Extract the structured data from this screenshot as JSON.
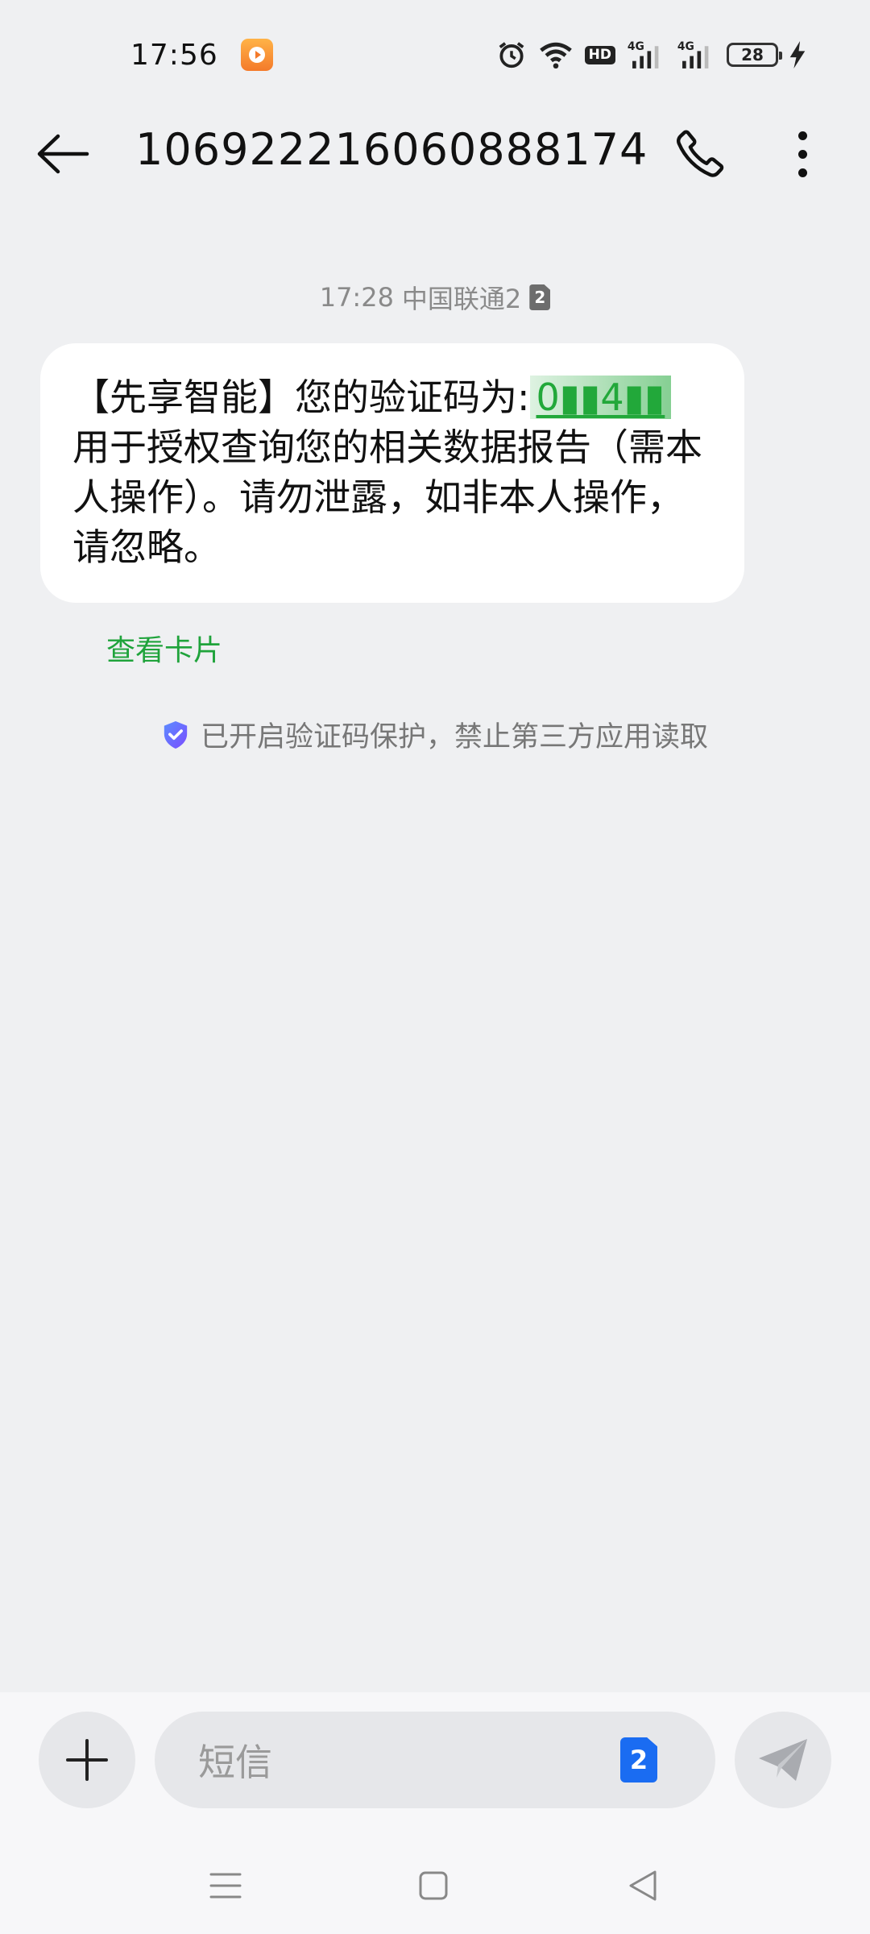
{
  "status_bar": {
    "time": "17:56",
    "hd_label": "HD",
    "net1": "4G",
    "net2": "4G",
    "battery": "28"
  },
  "header": {
    "title": "106922216060888174"
  },
  "message": {
    "time": "17:28",
    "carrier": "中国联通2",
    "sim_number": "2",
    "text_prefix": "【先享智能】您的验证码为:",
    "code": "0▮▮4▮▮",
    "text_suffix": " 用于授权查询您的相关数据报告（需本人操作）。请勿泄露，如非本人操作，请忽略。",
    "view_card": "查看卡片"
  },
  "protection_notice": "已开启验证码保护，禁止第三方应用读取",
  "input": {
    "placeholder": "短信",
    "sim_number": "2"
  },
  "colors": {
    "accent_green": "#1fa33b",
    "sim_blue": "#1a6cf2",
    "background": "#eff0f2"
  }
}
